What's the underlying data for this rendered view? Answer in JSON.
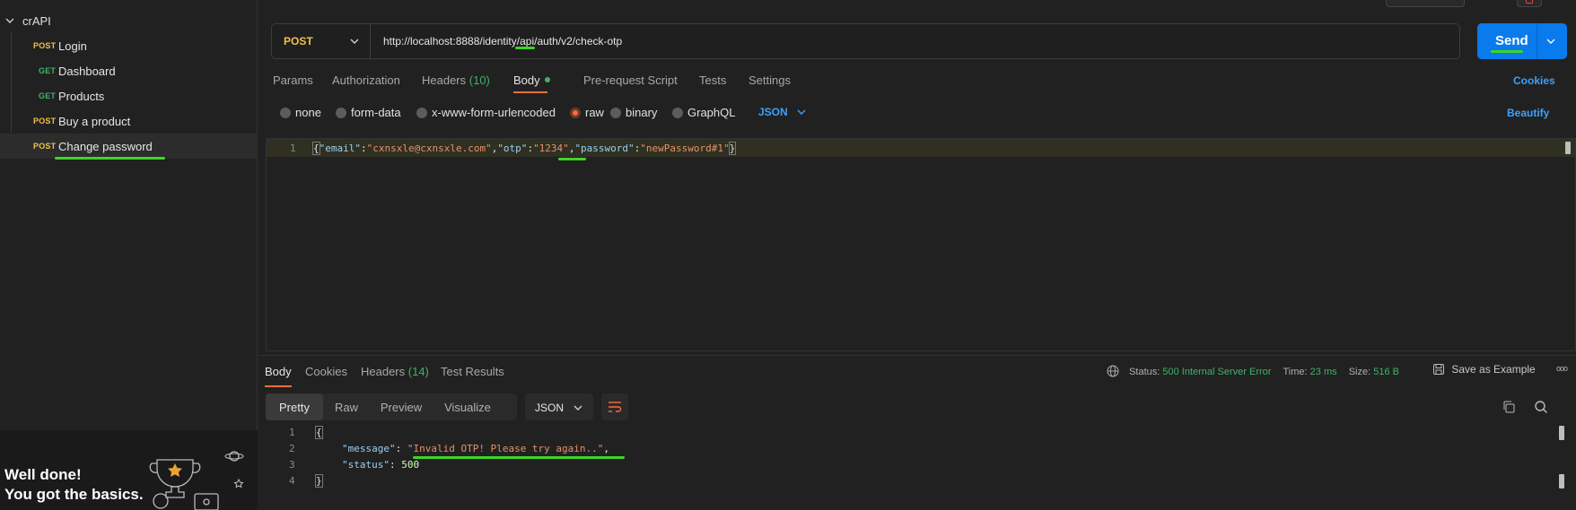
{
  "sidebar": {
    "collection_name": "crAPI",
    "requests": [
      {
        "method": "POST",
        "label": "Login"
      },
      {
        "method": "GET",
        "label": "Dashboard"
      },
      {
        "method": "GET",
        "label": "Products"
      },
      {
        "method": "POST",
        "label": "Buy a product"
      },
      {
        "method": "POST",
        "label": "Change password"
      }
    ],
    "promo_line1": "Well done!",
    "promo_line2": "You got the basics."
  },
  "request": {
    "method": "POST",
    "url": "http://localhost:8888/identity/api/auth/v2/check-otp",
    "send_label": "Send",
    "tabs": [
      {
        "label": "Params"
      },
      {
        "label": "Authorization"
      },
      {
        "label": "Headers",
        "count": "(10)"
      },
      {
        "label": "Body"
      },
      {
        "label": "Pre-request Script"
      },
      {
        "label": "Tests"
      },
      {
        "label": "Settings"
      }
    ],
    "cookies_label": "Cookies",
    "body_types": [
      "none",
      "form-data",
      "x-www-form-urlencoded",
      "raw",
      "binary",
      "GraphQL"
    ],
    "selected_body_type": "raw",
    "body_format": "JSON",
    "beautify_label": "Beautify",
    "body_line_number": "1",
    "body": {
      "open": "{",
      "k1": "\"email\"",
      "v1": "\"cxnsxle@cxnsxle.com\"",
      "k2": "\"otp\"",
      "v2": "\"1234\"",
      "k3": "\"password\"",
      "v3": "\"newPassword#1\"",
      "close": "}"
    }
  },
  "response": {
    "tabs": [
      {
        "label": "Body"
      },
      {
        "label": "Cookies"
      },
      {
        "label": "Headers",
        "count": "(14)"
      },
      {
        "label": "Test Results"
      }
    ],
    "status_label": "Status:",
    "status_value": "500 Internal Server Error",
    "time_label": "Time:",
    "time_value": "23 ms",
    "size_label": "Size:",
    "size_value": "516 B",
    "save_example_label": "Save as Example",
    "more_label": "ooo",
    "views": [
      "Pretty",
      "Raw",
      "Preview",
      "Visualize"
    ],
    "format": "JSON",
    "line_numbers": [
      "1",
      "2",
      "3",
      "4"
    ],
    "json": {
      "open": "{",
      "message_key": "\"message\"",
      "message_value": "\"Invalid OTP! Please try again..\"",
      "status_key": "\"status\"",
      "status_value": "500",
      "close": "}"
    }
  },
  "colors": {
    "post": "#f0c14a",
    "get": "#3fb368",
    "accent": "#ff6c37",
    "send": "#097bed",
    "highlight": "#3fd429"
  }
}
